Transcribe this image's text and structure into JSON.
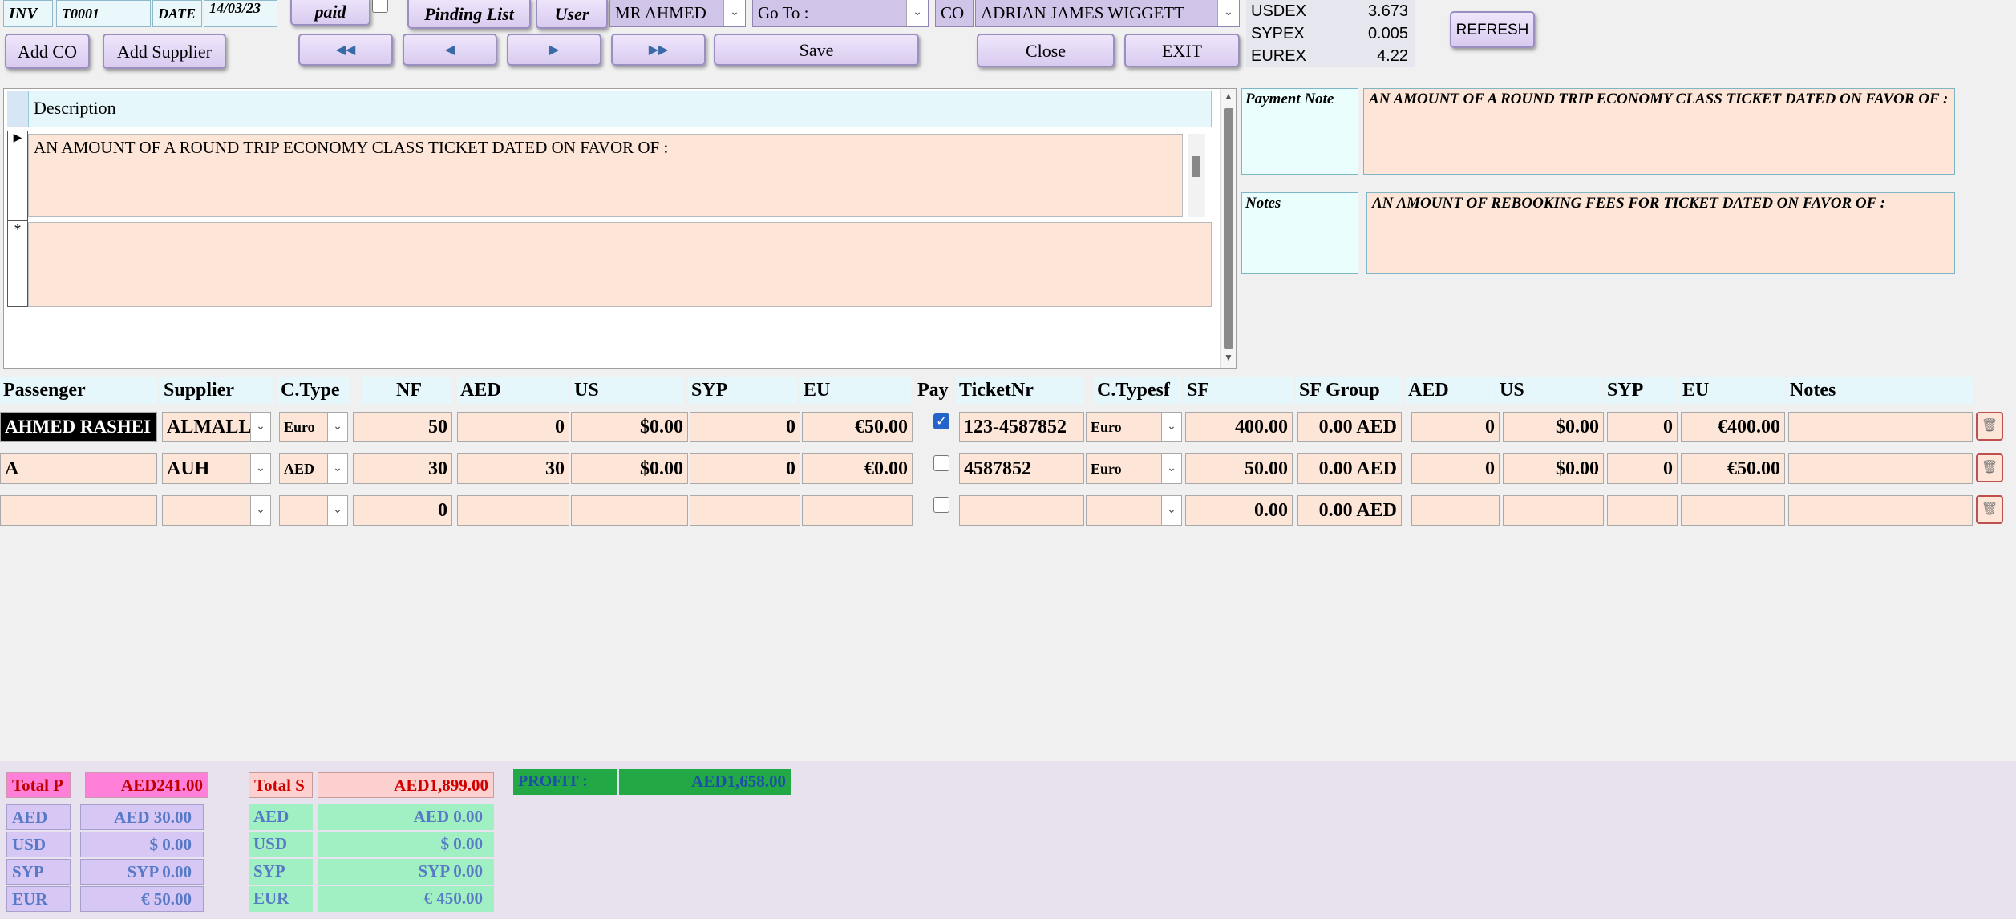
{
  "header": {
    "inv_label": "INV",
    "inv_value": "T0001",
    "date_label": "DATE",
    "date_value": "14/03/23",
    "paid_label": "paid",
    "pending_label": "Pinding List",
    "user_label": "User",
    "user_value": "MR AHMED",
    "goto_label": "Go To :",
    "goto_value": "",
    "co_label": "CO",
    "co_value": "ADRIAN JAMES WIGGETT",
    "add_co_label": "Add CO",
    "add_supplier_label": "Add Supplier",
    "save_label": "Save",
    "close_label": "Close",
    "exit_label": "EXIT",
    "refresh_label": "REFRESH"
  },
  "rates": [
    {
      "label": "USDEX",
      "value": "3.673"
    },
    {
      "label": "SYPEX",
      "value": "0.005"
    },
    {
      "label": "EUREX",
      "value": "4.22"
    }
  ],
  "description": {
    "header": "Description",
    "row1": "AN AMOUNT OF A ROUND TRIP ECONOMY CLASS TICKET DATED ON FAVOR OF :",
    "new_row_marker": "*"
  },
  "payment_note": {
    "label": "Payment Note",
    "value": "AN AMOUNT OF A ROUND TRIP ECONOMY CLASS TICKET DATED ON FAVOR OF :"
  },
  "notes": {
    "label": "Notes",
    "value": "AN AMOUNT OF REBOOKING FEES FOR TICKET DATED ON FAVOR OF :"
  },
  "grid": {
    "headers": {
      "passenger": "Passenger",
      "supplier": "Supplier",
      "ctype": "C.Type",
      "nf": "NF",
      "aed": "AED",
      "us": "US",
      "syp": "SYP",
      "eu": "EU",
      "pay": "Pay",
      "ticketnr": "TicketNr",
      "ctypesf": "C.Typesf",
      "sf": "SF",
      "sfgroup": "SF Group",
      "aed2": "AED",
      "us2": "US",
      "syp2": "SYP",
      "eu2": "EU",
      "notes": "Notes"
    },
    "rows": [
      {
        "passenger": "AHMED RASHEI",
        "supplier": "ALMALLA",
        "ctype": "Euro",
        "nf": "50",
        "aed": "0",
        "us": "$0.00",
        "syp": "0",
        "eu": "€50.00",
        "pay": true,
        "ticketnr": "123-4587852",
        "ctypesf": "Euro",
        "sf": "400.00",
        "sfgroup": "0.00 AED",
        "aed2": "0",
        "us2": "$0.00",
        "syp2": "0",
        "eu2": "€400.00",
        "notes": ""
      },
      {
        "passenger": "A",
        "supplier": "AUH",
        "ctype": "AED",
        "nf": "30",
        "aed": "30",
        "us": "$0.00",
        "syp": "0",
        "eu": "€0.00",
        "pay": false,
        "ticketnr": "4587852",
        "ctypesf": "Euro",
        "sf": "50.00",
        "sfgroup": "0.00 AED",
        "aed2": "0",
        "us2": "$0.00",
        "syp2": "0",
        "eu2": "€50.00",
        "notes": ""
      },
      {
        "passenger": "",
        "supplier": "",
        "ctype": "",
        "nf": "0",
        "aed": "",
        "us": "",
        "syp": "",
        "eu": "",
        "pay": false,
        "ticketnr": "",
        "ctypesf": "",
        "sf": "0.00",
        "sfgroup": "0.00 AED",
        "aed2": "",
        "us2": "",
        "syp2": "",
        "eu2": "",
        "notes": ""
      }
    ]
  },
  "totals": {
    "total_p_label": "Total P",
    "total_p_value": "AED241.00",
    "total_s_label": "Total S",
    "total_s_value": "AED1,899.00",
    "profit_label": "PROFIT :",
    "profit_value": "AED1,658.00",
    "p_breakdown": [
      {
        "label": "AED",
        "value": "AED  30.00"
      },
      {
        "label": "USD",
        "value": "$  0.00"
      },
      {
        "label": "SYP",
        "value": "SYP  0.00"
      },
      {
        "label": "EUR",
        "value": "€  50.00"
      }
    ],
    "s_breakdown": [
      {
        "label": "AED",
        "value": "AED  0.00"
      },
      {
        "label": "USD",
        "value": "$  0.00"
      },
      {
        "label": "SYP",
        "value": "SYP  0.00"
      },
      {
        "label": "EUR",
        "value": "€  450.00"
      }
    ]
  },
  "colors": {
    "peach": "#fde6d8",
    "lavender": "#d9cbf0",
    "total_p": "#ff7fd9",
    "total_s": "#fdd0d0",
    "green": "#a0f0c4",
    "profit": "#22a845"
  }
}
